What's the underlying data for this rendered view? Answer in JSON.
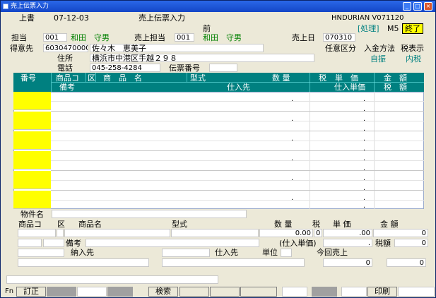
{
  "window": {
    "title": "売上伝票入力"
  },
  "header": {
    "mode": "上書",
    "date": "07-12-03",
    "screen_title": "売上伝票入力",
    "system_id": "HNDURIAN  V071120",
    "process_label": "[処理]",
    "process_value": "M5",
    "exit_button": "終了",
    "prev_label": "前"
  },
  "customer": {
    "tanto_label": "担当",
    "tanto_code": "001",
    "tanto_name": "和田　守男",
    "uri_tanto_label": "売上担当",
    "uri_tanto_code": "001",
    "uri_tanto_name": "和田　守男",
    "uriage_bi_label": "売上日",
    "uriage_bi": "070310",
    "tokuisaki_label": "得意先",
    "tokuisaki_code": "6030470000",
    "tokuisaki_name": "佐々木　恵美子",
    "jusho_label": "住所",
    "jusho": "横浜市中港区手越２９８",
    "denwa_label": "電話",
    "denwa": "045-258-4284",
    "denpyo_label": "伝票番号",
    "denpyo": "",
    "nin_label": "任意区分",
    "nyukin_label": "入金方法",
    "nyukin": "自振",
    "zeihyoji_label": "税表示",
    "zeihyoji": "内税"
  },
  "grid": {
    "h_bango": "番号",
    "h_shohin_code": "商品コ",
    "h_ku": "区",
    "h_shohin_mei": "商　品　名",
    "h_kata": "型式",
    "h_suryo": "数 量",
    "h_zei": "税",
    "h_tanka": "単　価",
    "h_kingaku": "金　額",
    "h_biko": "備考",
    "h_shiiresaki": "仕入先",
    "h_shiire_tanka": "仕入単価",
    "h_zeigaku": "税　額",
    "dot": "."
  },
  "detail": {
    "bukken_label": "物件名",
    "shohin_code_label": "商品コ",
    "ku_label": "区",
    "shohin_mei_label": "商品名",
    "kata_label": "型式",
    "suryo_label": "数 量",
    "zei_label": "税",
    "tanka_label": "単 価",
    "kingaku_label": "金 額",
    "suryo": "0.00",
    "zei": "0",
    "tanka": ".00",
    "kingaku": "0",
    "biko_label": "備考",
    "shiire_tanka_label": "(仕入単価)",
    "shiire_tanka": ".",
    "zeigaku_label": "税額",
    "zeigaku": "0",
    "nonyusaki_label": "納入先",
    "shiiresaki_label": "仕入先",
    "tani_label": "単位",
    "konkai_label": "今回売上",
    "konkai_val1": "0",
    "konkai_val2": "0"
  },
  "fkeys": {
    "fn": "Fn",
    "teisei": "訂正",
    "kensaku": "検索",
    "insatsu": "印刷"
  }
}
